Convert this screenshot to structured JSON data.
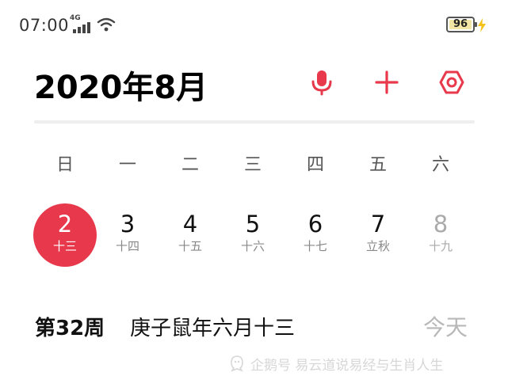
{
  "status_bar": {
    "time": "07:00",
    "network": "4G",
    "battery_level": "96",
    "battery_fill_color": "#f3e5a3",
    "charging_icon": "bolt-icon"
  },
  "header": {
    "title": "2020年8月",
    "accent_color": "#e8394c",
    "icons": [
      "microphone-icon",
      "plus-icon",
      "settings-icon"
    ]
  },
  "weekdays": [
    "日",
    "一",
    "二",
    "三",
    "四",
    "五",
    "六"
  ],
  "days": [
    {
      "day": "2",
      "lunar": "十三",
      "selected": true
    },
    {
      "day": "3",
      "lunar": "十四"
    },
    {
      "day": "4",
      "lunar": "十五"
    },
    {
      "day": "5",
      "lunar": "十六"
    },
    {
      "day": "6",
      "lunar": "十七"
    },
    {
      "day": "7",
      "lunar": "立秋"
    },
    {
      "day": "8",
      "lunar": "十九",
      "muted": true
    }
  ],
  "info": {
    "week": "第32周",
    "lunar_date": "庚子鼠年六月十三",
    "today_label": "今天"
  },
  "watermark": {
    "text": "企鹅号 易云道说易经与生肖人生"
  }
}
